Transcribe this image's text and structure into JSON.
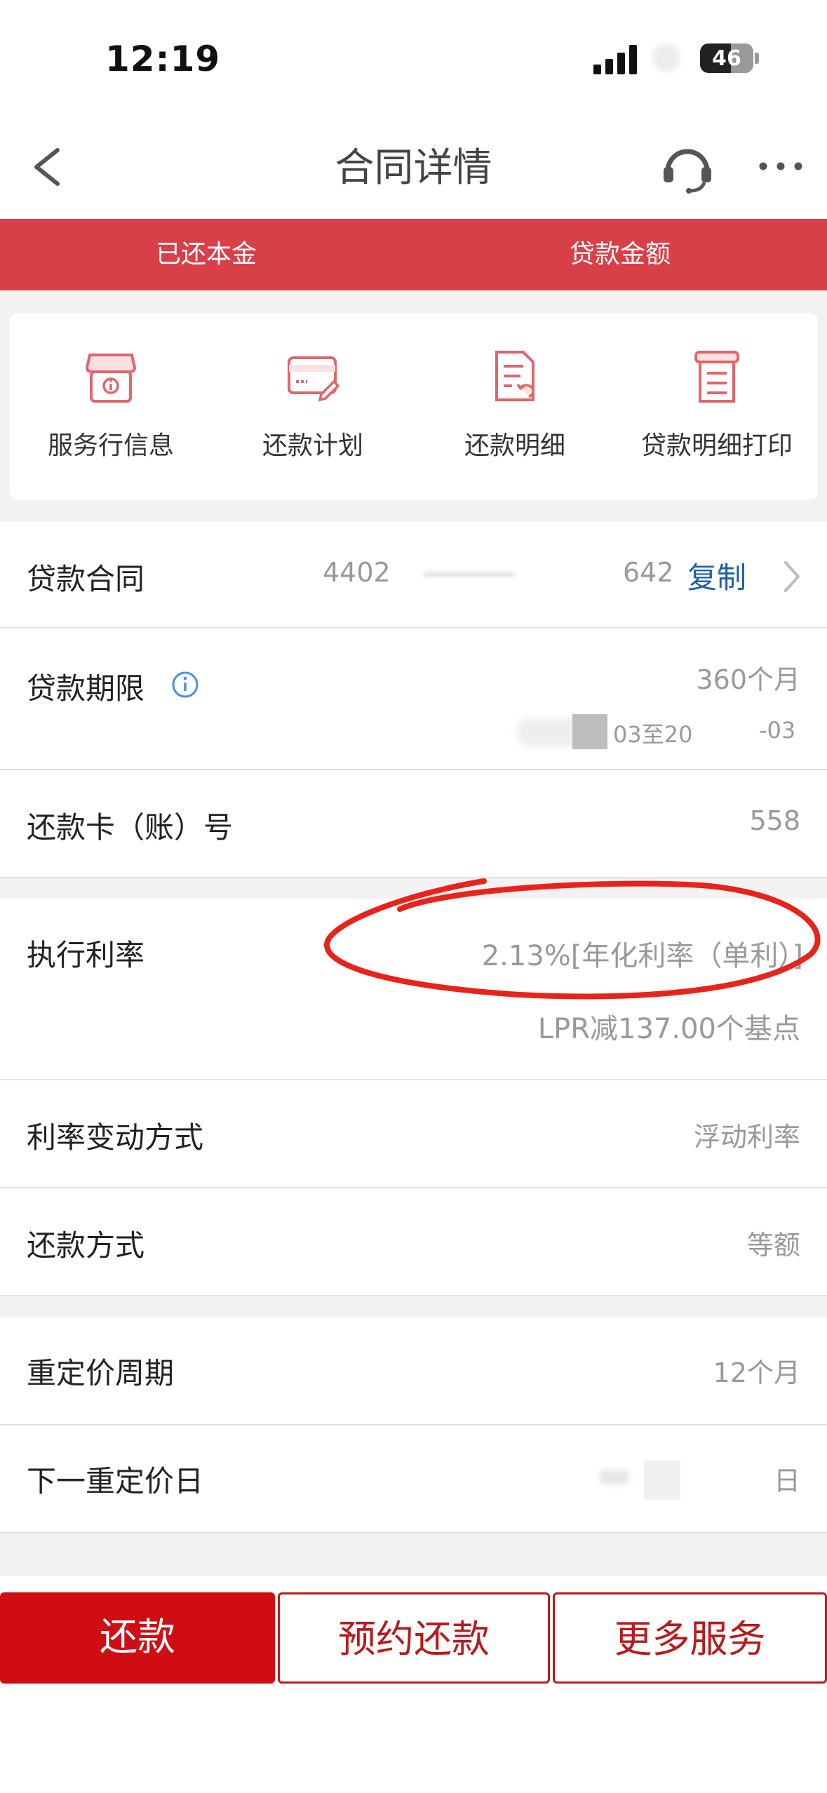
{
  "status_bar": {
    "time": "12:19",
    "battery": "46"
  },
  "nav": {
    "title": "合同详情",
    "back_icon": "chevron-left-icon",
    "support_icon": "headset-icon",
    "more_icon": "more-horizontal-icon"
  },
  "summary_header": {
    "repaid_principal_label": "已还本金",
    "loan_amount_label": "贷款金额"
  },
  "services": [
    {
      "label": "服务行信息",
      "icon": "bank-info-icon"
    },
    {
      "label": "还款计划",
      "icon": "card-edit-icon"
    },
    {
      "label": "还款明细",
      "icon": "document-return-icon"
    },
    {
      "label": "贷款明细打印",
      "icon": "print-document-icon"
    }
  ],
  "details": {
    "contract": {
      "label": "贷款合同",
      "value_start": "4402",
      "value_end": "642",
      "copy_label": "复制"
    },
    "term": {
      "label": "贷款期限",
      "value": "360个月",
      "range_a": "03至20",
      "range_b": "-03"
    },
    "card": {
      "label": "还款卡（账）号",
      "value": "558"
    },
    "rate": {
      "label": "执行利率",
      "value": "2.13%[年化利率（单利）]",
      "sub_value": "LPR减137.00个基点"
    },
    "rate_change": {
      "label": "利率变动方式",
      "value": "浮动利率"
    },
    "repay_method": {
      "label": "还款方式",
      "value": "等额"
    },
    "reprice_period": {
      "label": "重定价周期",
      "value": "12个月"
    },
    "next_reprice": {
      "label": "下一重定价日",
      "value": "日"
    }
  },
  "actions": {
    "repay": "还款",
    "schedule_repay": "预约还款",
    "more_services": "更多服务"
  },
  "colors": {
    "brand_red": "#d93f46",
    "button_red": "#cf0d13",
    "link_blue": "#1f5fa8",
    "annotation_red": "#e8231b"
  }
}
